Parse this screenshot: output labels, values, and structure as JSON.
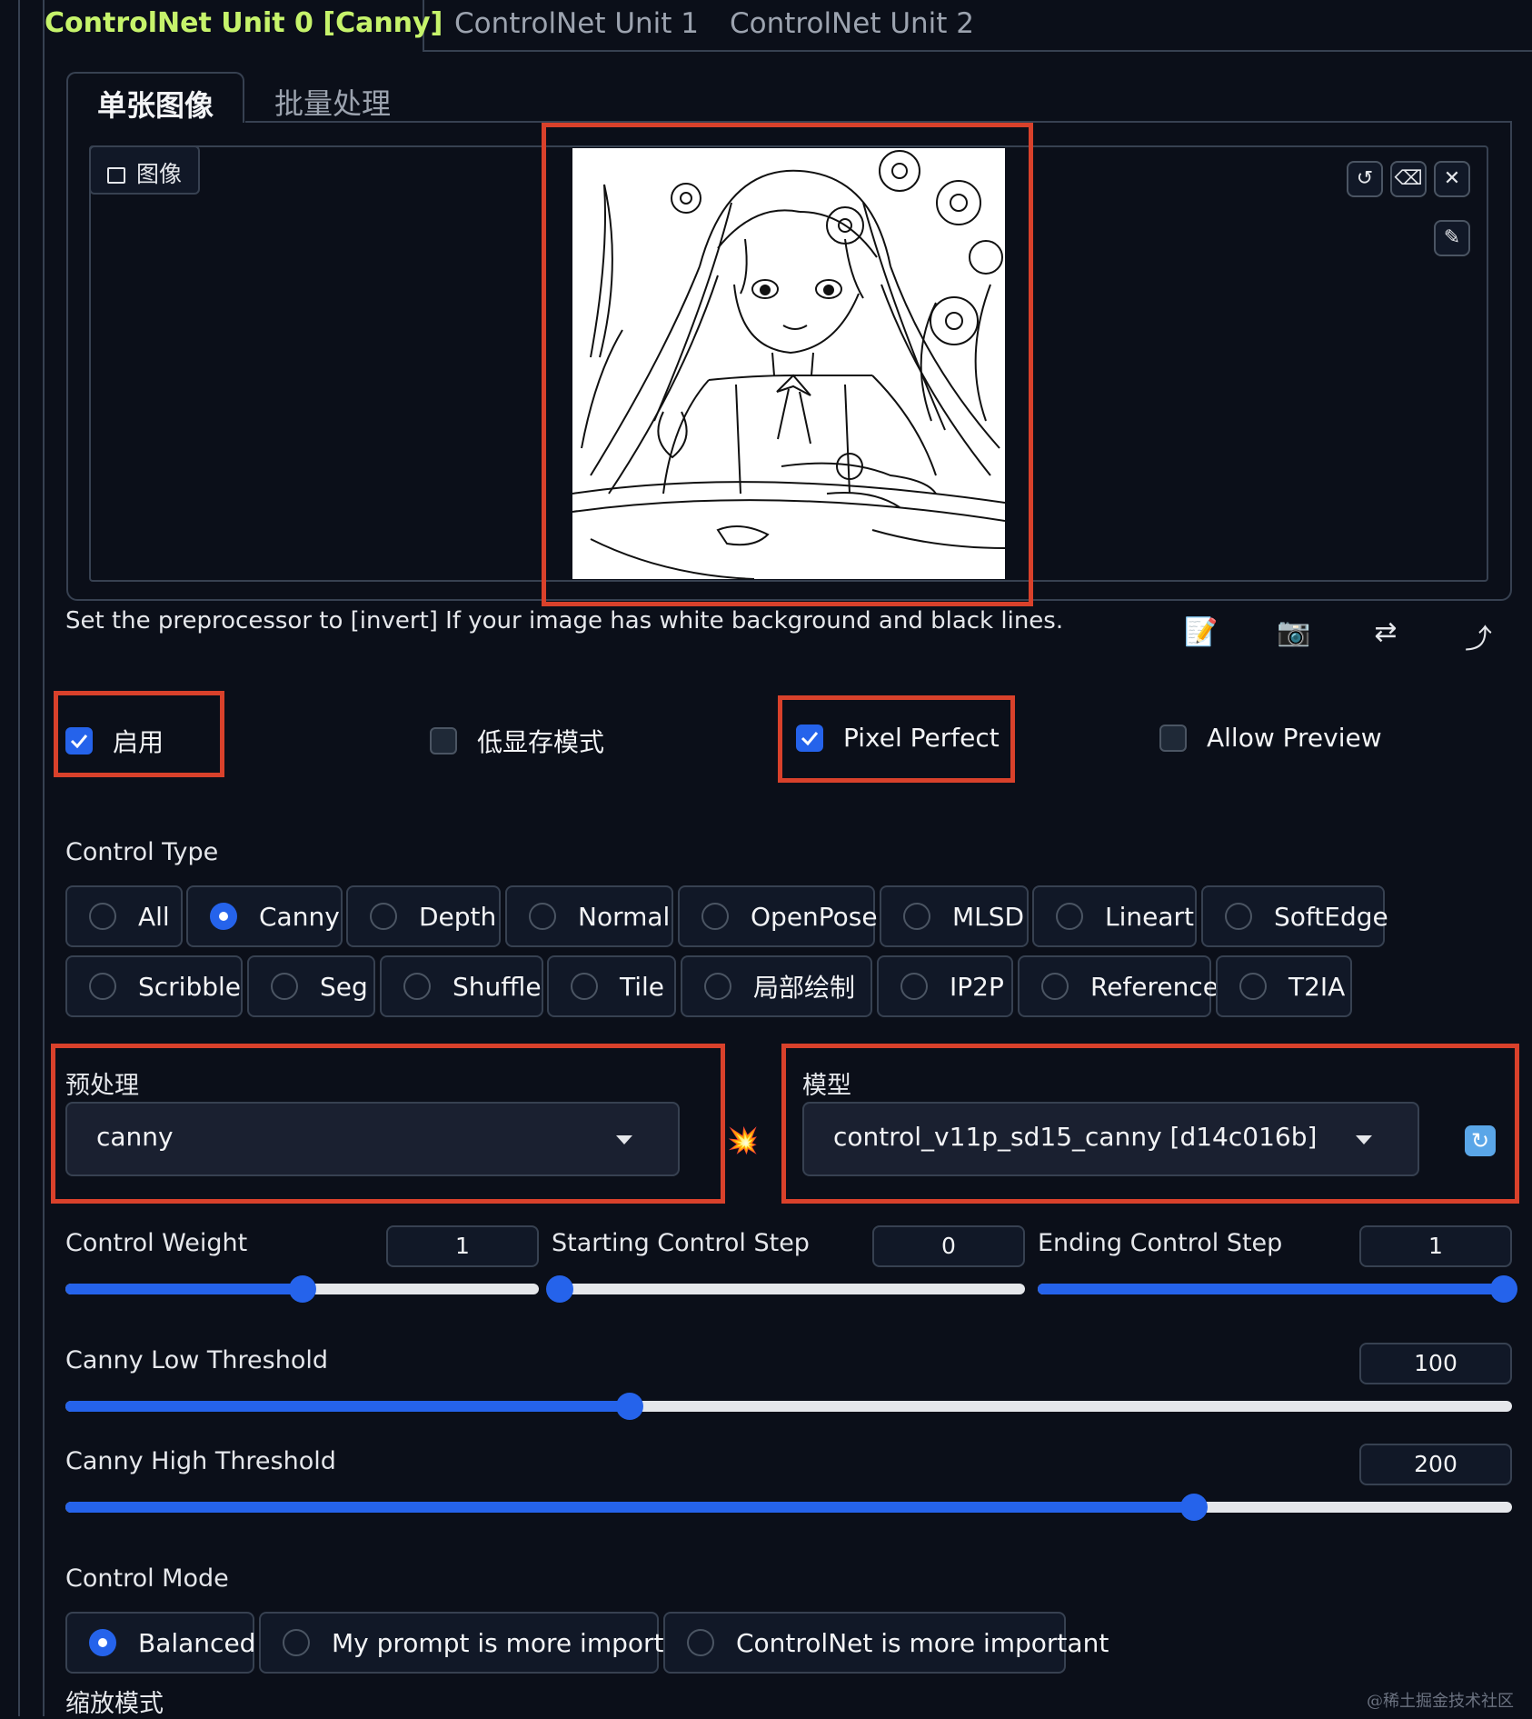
{
  "tabs": {
    "unit0": "ControlNet Unit 0 [Canny]",
    "unit1": "ControlNet Unit 1",
    "unit2": "ControlNet Unit 2"
  },
  "subtabs": {
    "single": "单张图像",
    "batch": "批量处理"
  },
  "image": {
    "label": "图像",
    "hint": "Set the preprocessor to [invert] If your image has white background and black lines.",
    "icons": [
      "undo-icon",
      "eraser-icon",
      "close-icon",
      "brush-icon"
    ],
    "tools": [
      "notepad-icon",
      "camera-icon",
      "swap-icon",
      "upload-arrow-icon"
    ]
  },
  "checkboxes": {
    "enable": {
      "label": "启用",
      "checked": true
    },
    "lowvram": {
      "label": "低显存模式",
      "checked": false
    },
    "pixel_perfect": {
      "label": "Pixel Perfect",
      "checked": true
    },
    "allow_preview": {
      "label": "Allow Preview",
      "checked": false
    }
  },
  "control_type": {
    "label": "Control Type",
    "row1": [
      "All",
      "Canny",
      "Depth",
      "Normal",
      "OpenPose",
      "MLSD",
      "Lineart",
      "SoftEdge"
    ],
    "row2": [
      "Scribble",
      "Seg",
      "Shuffle",
      "Tile",
      "局部绘制",
      "IP2P",
      "Reference",
      "T2IA"
    ],
    "selected": "Canny"
  },
  "preprocessor": {
    "label": "预处理",
    "value": "canny",
    "run_icon": "explosion-icon"
  },
  "model": {
    "label": "模型",
    "value": "control_v11p_sd15_canny [d14c016b]",
    "refresh_icon": "refresh-icon"
  },
  "sliders": {
    "control_weight": {
      "label": "Control Weight",
      "value": "1",
      "fraction": 0.5
    },
    "starting_step": {
      "label": "Starting Control Step",
      "value": "0",
      "fraction": 0.0
    },
    "ending_step": {
      "label": "Ending Control Step",
      "value": "1",
      "fraction": 1.0
    },
    "canny_low": {
      "label": "Canny Low Threshold",
      "value": "100",
      "fraction": 0.39
    },
    "canny_high": {
      "label": "Canny High Threshold",
      "value": "200",
      "fraction": 0.78
    }
  },
  "control_mode": {
    "label": "Control Mode",
    "options": [
      "Balanced",
      "My prompt is more important",
      "ControlNet is more important"
    ],
    "selected": "Balanced"
  },
  "resize_mode": {
    "label": "缩放模式"
  },
  "watermark": "@稀土掘金技术社区"
}
